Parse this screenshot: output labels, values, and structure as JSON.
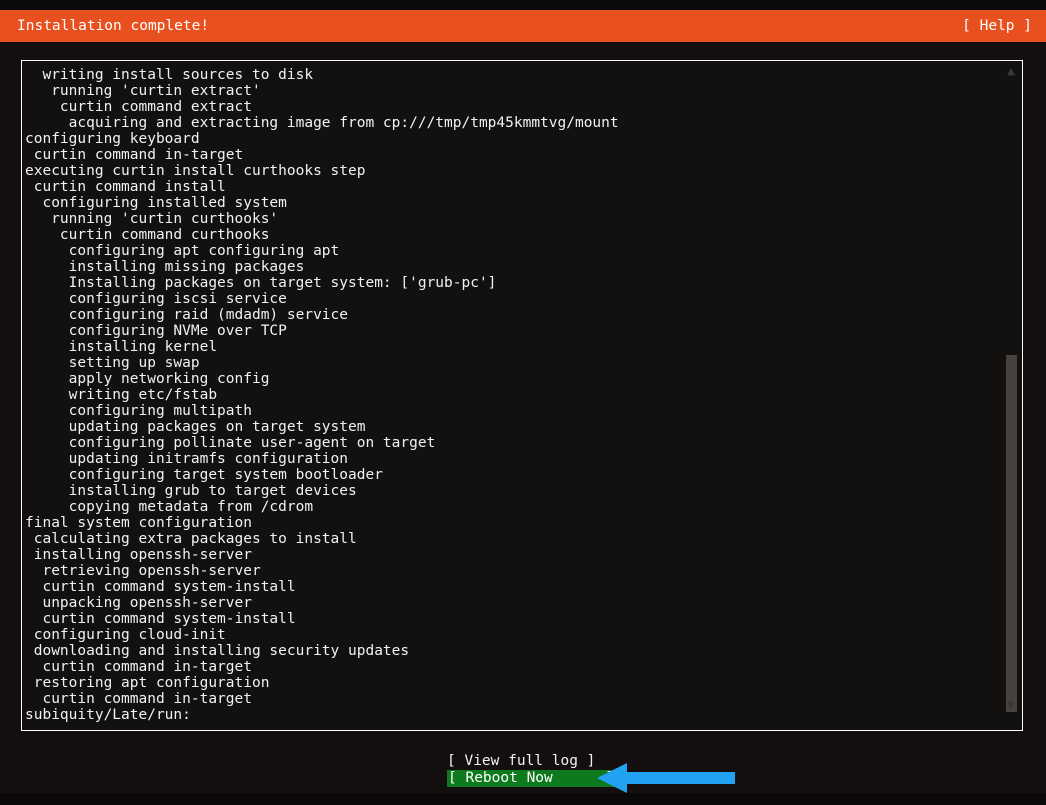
{
  "window": {
    "title": "Installation complete!",
    "help_label": "[ Help ]",
    "header_bg": "#E8501F"
  },
  "log": {
    "lines": [
      "  writing install sources to disk",
      "   running 'curtin extract'",
      "    curtin command extract",
      "     acquiring and extracting image from cp:///tmp/tmp45kmmtvg/mount",
      "configuring keyboard",
      " curtin command in-target",
      "executing curtin install curthooks step",
      " curtin command install",
      "  configuring installed system",
      "   running 'curtin curthooks'",
      "    curtin command curthooks",
      "     configuring apt configuring apt",
      "     installing missing packages",
      "     Installing packages on target system: ['grub-pc']",
      "     configuring iscsi service",
      "     configuring raid (mdadm) service",
      "     configuring NVMe over TCP",
      "     installing kernel",
      "     setting up swap",
      "     apply networking config",
      "     writing etc/fstab",
      "     configuring multipath",
      "     updating packages on target system",
      "     configuring pollinate user-agent on target",
      "     updating initramfs configuration",
      "     configuring target system bootloader",
      "     installing grub to target devices",
      "     copying metadata from /cdrom",
      "final system configuration",
      " calculating extra packages to install",
      " installing openssh-server",
      "  retrieving openssh-server",
      "  curtin command system-install",
      "  unpacking openssh-server",
      "  curtin command system-install",
      " configuring cloud-init",
      " downloading and installing security updates",
      "  curtin command in-target",
      " restoring apt configuration",
      "  curtin command in-target",
      "subiquity/Late/run:"
    ],
    "text_color": "#F2F2F2",
    "background": "#121110"
  },
  "scrollbar": {
    "up_arrow_glyph": "▲",
    "down_arrow_glyph": "▼",
    "thumb_color": "#46433F"
  },
  "footer": {
    "view_log_label": "[ View full log ]",
    "reboot_label": "[ Reboot Now      ]",
    "reboot_highlight_color": "#0D7A1E"
  },
  "annotation": {
    "arrow_color": "#21A1F1",
    "arrow_direction": "left",
    "points_at": "reboot-now-button"
  }
}
